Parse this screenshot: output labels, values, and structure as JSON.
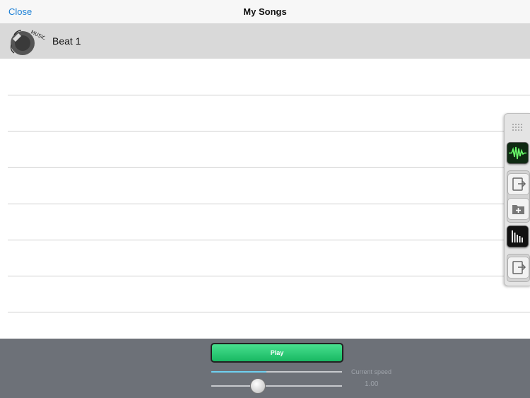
{
  "navbar": {
    "close_label": "Close",
    "title": "My Songs"
  },
  "songs": [
    {
      "label": "Beat 1",
      "icon": "music-disc-icon"
    }
  ],
  "toolbar": {
    "items": [
      {
        "icon": "grip-icon"
      },
      {
        "icon": "waveform-icon"
      },
      {
        "icon": "export-icon"
      },
      {
        "icon": "add-folder-icon"
      },
      {
        "icon": "levels-icon"
      },
      {
        "icon": "export-icon"
      }
    ]
  },
  "player": {
    "play_label": "Play",
    "progress": 0.42,
    "speed_label": "Current speed",
    "speed_value": "1.00",
    "speed_position": 0.35
  },
  "colors": {
    "accent": "#1a7fd6",
    "play": "#2ed17a",
    "bottom_bar": "#6d7178"
  }
}
